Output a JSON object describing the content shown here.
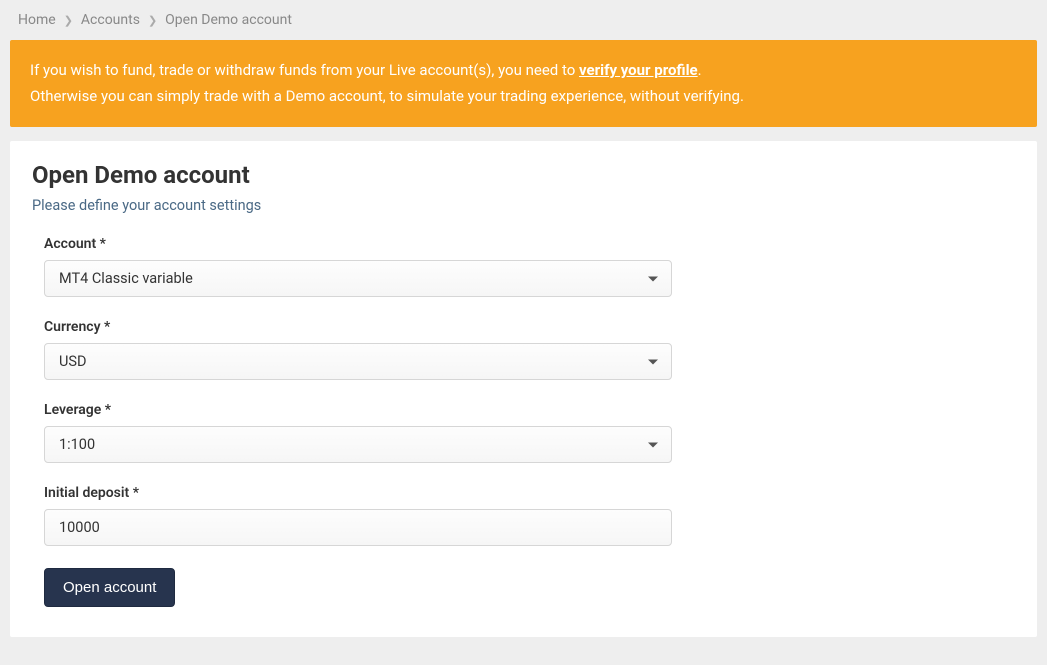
{
  "breadcrumb": {
    "items": [
      {
        "label": "Home"
      },
      {
        "label": "Accounts"
      },
      {
        "label": "Open Demo account"
      }
    ]
  },
  "alert": {
    "line1_prefix": "If you wish to fund, trade or withdraw funds from your Live account(s), you need to ",
    "link_text": "verify your profile",
    "line1_suffix": ".",
    "line2": "Otherwise you can simply trade with a Demo account, to simulate your trading experience, without verifying."
  },
  "page": {
    "title": "Open Demo account",
    "subtext": "Please define your account settings"
  },
  "form": {
    "account": {
      "label": "Account *",
      "value": "MT4 Classic variable"
    },
    "currency": {
      "label": "Currency *",
      "value": "USD"
    },
    "leverage": {
      "label": "Leverage *",
      "value": "1:100"
    },
    "initial_deposit": {
      "label": "Initial deposit *",
      "value": "10000"
    },
    "submit_label": "Open account"
  }
}
